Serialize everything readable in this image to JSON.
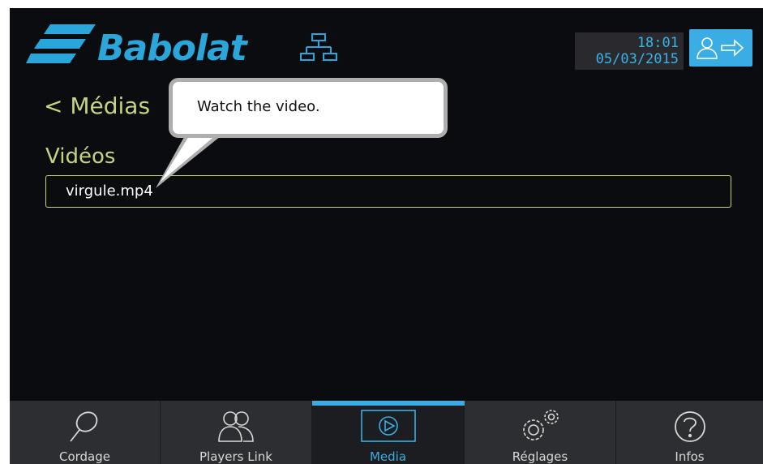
{
  "brand": {
    "name": "Babolat"
  },
  "clock": {
    "time": "18:01",
    "date": "05/03/2015"
  },
  "back": {
    "label": "< Médias"
  },
  "section": {
    "title": "Vidéos"
  },
  "files": [
    {
      "name": "virgule.mp4"
    }
  ],
  "tooltip": {
    "text": "Watch the video."
  },
  "nav": {
    "items": [
      {
        "label": "Cordage",
        "icon": "racket-icon"
      },
      {
        "label": "Players Link",
        "icon": "players-icon"
      },
      {
        "label": "Media",
        "icon": "play-icon",
        "active": true
      },
      {
        "label": "Réglages",
        "icon": "gears-icon"
      },
      {
        "label": "Infos",
        "icon": "help-icon"
      }
    ]
  },
  "colors": {
    "accent": "#3aaee4",
    "label_green": "#c5d47f",
    "background": "#0b0c0f",
    "nav_bg": "#2d2e31"
  }
}
